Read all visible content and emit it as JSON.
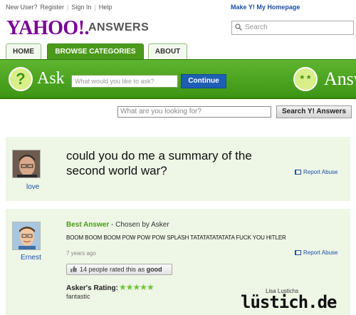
{
  "topbar": {
    "new_user": "New User?",
    "register": "Register",
    "sign_in": "Sign In",
    "help": "Help",
    "homepage": "Make Y! My Homepage"
  },
  "brand": {
    "logo": "YAHOO!.",
    "product": "ANSWERS"
  },
  "search_top": {
    "placeholder": "Search"
  },
  "tabs": [
    {
      "label": "HOME"
    },
    {
      "label": "BROWSE CATEGORIES",
      "active": true
    },
    {
      "label": "ABOUT"
    }
  ],
  "ask_bar": {
    "label": "Ask",
    "placeholder": "What would you like to ask?",
    "button": "Continue",
    "right_label": "Answ"
  },
  "search_main": {
    "placeholder": "What are you looking for?",
    "button": "Search Y! Answers"
  },
  "question": {
    "user": "love",
    "text": "could you do me a summary of the second world war?",
    "report": "Report Abuse"
  },
  "best_answer": {
    "heading": "Best Answer",
    "chosen_by": " - Chosen by Asker",
    "user": "Ernest",
    "text": "BOOM BOOM BOOM POW POW POW SPLASH TATATATATATATA  FUCK YOU HITLER",
    "age": "7 years ago",
    "report": "Report Abuse",
    "rated_prefix": "14 people rated this as ",
    "rated_value": "good",
    "rating_label": "Asker's Rating:",
    "stars": "★★★★★",
    "rating_value": 5,
    "comment": "fantastic"
  },
  "watermark": {
    "small": "Lisa Lustichs",
    "big": "lüstich.de"
  },
  "colors": {
    "brand_purple": "#7b0099",
    "green": "#4b9a1b",
    "link": "#1a4fa8",
    "panel": "#eef6e6"
  }
}
